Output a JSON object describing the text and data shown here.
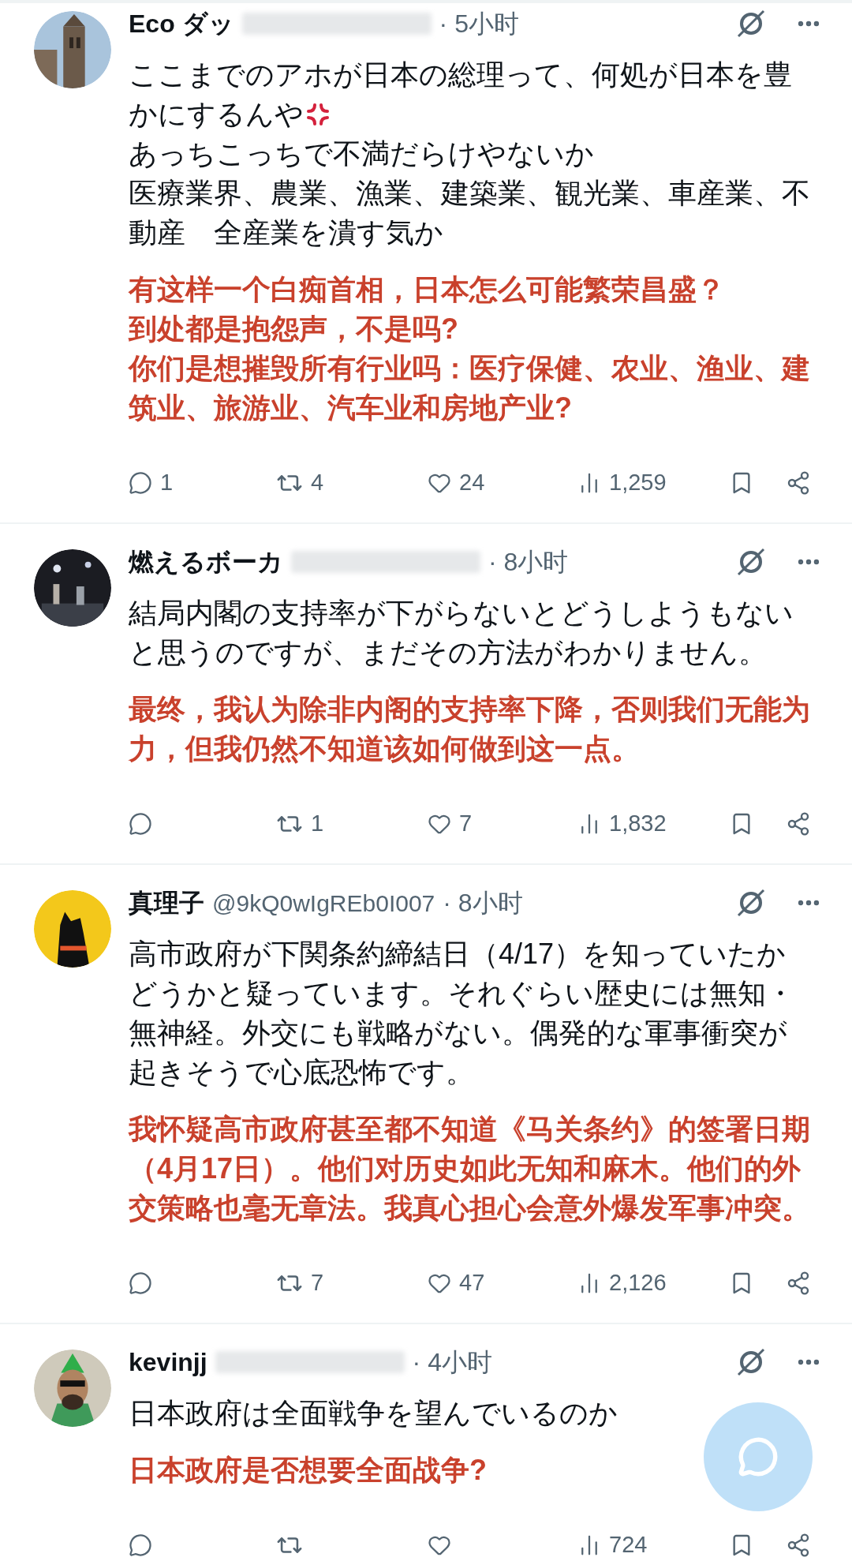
{
  "posts": [
    {
      "author": "Eco ダッ",
      "redacted": true,
      "time": "· 5小时",
      "text": [
        "ここまでのアホが日本の総理って、何処が日本を豊かにするんや",
        "あっちこっちで不満だらけやないか",
        "医療業界、農業、漁業、建築業、観光業、車産業、不動産　全産業を潰す気か"
      ],
      "anger_mark": true,
      "translation": [
        "有这样一个白痴首相，日本怎么可能繁荣昌盛？",
        "到处都是抱怨声，不是吗?",
        "你们是想摧毁所有行业吗：医疗保健、农业、渔业、建筑业、旅游业、汽车业和房地产业?"
      ],
      "actions": [
        {
          "kind": "reply",
          "count": "1"
        },
        {
          "kind": "retweet",
          "count": "4"
        },
        {
          "kind": "like",
          "count": "24"
        },
        {
          "kind": "views",
          "count": "1,259"
        },
        {
          "kind": "bookmark"
        },
        {
          "kind": "share"
        }
      ]
    },
    {
      "author": "燃えるボーカ",
      "redacted": true,
      "time": "· 8小时",
      "text": [
        "結局内閣の支持率が下がらないとどうしようもないと思うのですが、まだその方法がわかりません。"
      ],
      "translation": [
        "最终，我认为除非内阁的支持率下降，否则我们无能为力，但我仍然不知道该如何做到这一点。"
      ],
      "actions": [
        {
          "kind": "reply"
        },
        {
          "kind": "retweet",
          "count": "1"
        },
        {
          "kind": "like",
          "count": "7"
        },
        {
          "kind": "views",
          "count": "1,832"
        },
        {
          "kind": "bookmark"
        },
        {
          "kind": "share"
        }
      ]
    },
    {
      "author": "真理子",
      "handle": "@9kQ0wIgREb0I007",
      "redacted": false,
      "time": "· 8小时",
      "text": [
        "高市政府が下関条約締結日（4/17）を知っていたかどうかと疑っています。それぐらい歴史には無知・無神経。外交にも戦略がない。偶発的な軍事衝突が起きそうで心底恐怖です。"
      ],
      "translation": [
        "我怀疑高市政府甚至都不知道《马关条约》的签署日期（4月17日）。他们对历史如此无知和麻木。他们的外交策略也毫无章法。我真心担心会意外爆发军事冲突。"
      ],
      "actions": [
        {
          "kind": "reply"
        },
        {
          "kind": "retweet",
          "count": "7"
        },
        {
          "kind": "like",
          "count": "47"
        },
        {
          "kind": "views",
          "count": "2,126"
        },
        {
          "kind": "bookmark"
        },
        {
          "kind": "share"
        }
      ]
    },
    {
      "author": "kevinjj",
      "redacted": true,
      "time": "· 4小时",
      "text": [
        "日本政府は全面戦争を望んでいるのか"
      ],
      "translation": [
        "日本政府是否想要全面战争?"
      ],
      "actions": [
        {
          "kind": "reply"
        },
        {
          "kind": "retweet"
        },
        {
          "kind": "like"
        },
        {
          "kind": "views",
          "count": "724"
        },
        {
          "kind": "bookmark"
        },
        {
          "kind": "share"
        }
      ]
    }
  ]
}
